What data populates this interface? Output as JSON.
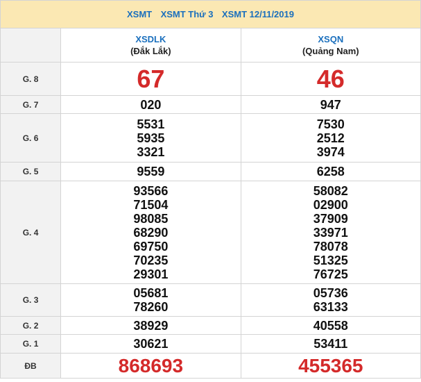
{
  "header": {
    "links": [
      "XSMT",
      "XSMT Thứ 3",
      "XSMT 12/11/2019"
    ]
  },
  "provinces": [
    {
      "code": "XSDLK",
      "name": "(Đắk Lắk)"
    },
    {
      "code": "XSQN",
      "name": "(Quảng Nam)"
    }
  ],
  "prizes": [
    {
      "label": "G. 8",
      "a": [
        "67"
      ],
      "b": [
        "46"
      ]
    },
    {
      "label": "G. 7",
      "a": [
        "020"
      ],
      "b": [
        "947"
      ]
    },
    {
      "label": "G. 6",
      "a": [
        "5531",
        "5935",
        "3321"
      ],
      "b": [
        "7530",
        "2512",
        "3974"
      ]
    },
    {
      "label": "G. 5",
      "a": [
        "9559"
      ],
      "b": [
        "6258"
      ]
    },
    {
      "label": "G. 4",
      "a": [
        "93566",
        "71504",
        "98085",
        "68290",
        "69750",
        "70235",
        "29301"
      ],
      "b": [
        "58082",
        "02900",
        "37909",
        "33971",
        "78078",
        "51325",
        "76725"
      ]
    },
    {
      "label": "G. 3",
      "a": [
        "05681",
        "78260"
      ],
      "b": [
        "05736",
        "63133"
      ]
    },
    {
      "label": "G. 2",
      "a": [
        "38929"
      ],
      "b": [
        "40558"
      ]
    },
    {
      "label": "G. 1",
      "a": [
        "30621"
      ],
      "b": [
        "53411"
      ]
    },
    {
      "label": "ĐB",
      "a": [
        "868693"
      ],
      "b": [
        "455365"
      ]
    }
  ],
  "colors": {
    "header_bg": "#fbe8b3",
    "link": "#1a6fbd",
    "highlight": "#d42a2a",
    "label_bg": "#f2f2f2"
  }
}
